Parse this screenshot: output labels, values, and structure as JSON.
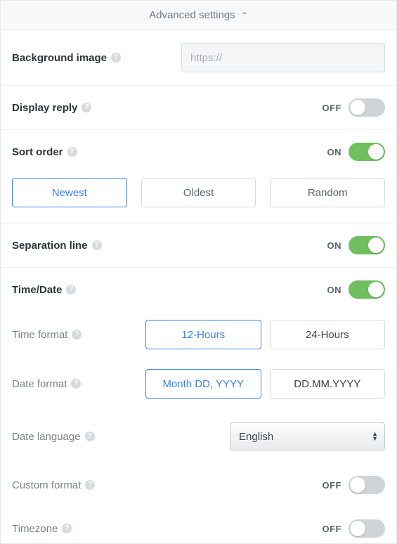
{
  "header": {
    "title": "Advanced settings"
  },
  "bg": {
    "label": "Background image",
    "placeholder": "https://"
  },
  "reply": {
    "label": "Display reply",
    "state": "OFF"
  },
  "sort": {
    "label": "Sort order",
    "state": "ON",
    "options": [
      "Newest",
      "Oldest",
      "Random"
    ],
    "selected": "Newest"
  },
  "sep": {
    "label": "Separation line",
    "state": "ON"
  },
  "timedate": {
    "label": "Time/Date",
    "state": "ON"
  },
  "timeformat": {
    "label": "Time format",
    "options": [
      "12-Hours",
      "24-Hours"
    ],
    "selected": "12-Hours"
  },
  "dateformat": {
    "label": "Date format",
    "options": [
      "Month DD, YYYY",
      "DD.MM.YYYY"
    ],
    "selected": "Month DD, YYYY"
  },
  "datelang": {
    "label": "Date language",
    "value": "English"
  },
  "customformat": {
    "label": "Custom format",
    "state": "OFF"
  },
  "timezone": {
    "label": "Timezone",
    "state": "OFF"
  }
}
